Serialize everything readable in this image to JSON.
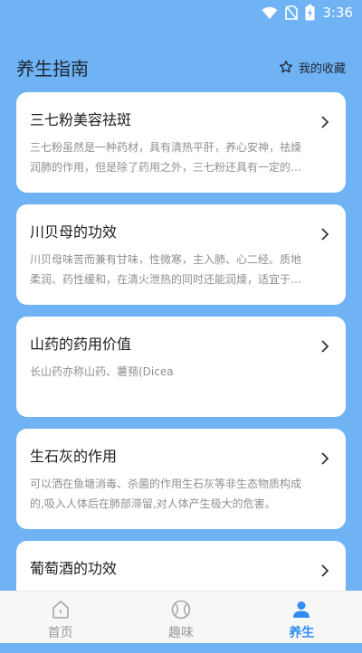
{
  "status": {
    "time": "3:36"
  },
  "header": {
    "title": "养生指南",
    "favorites_label": "我的收藏"
  },
  "cards": [
    {
      "title": "三七粉美容祛斑",
      "desc": "三七粉虽然是一种药材，具有清热平肝，养心安神，祛燥润肺的作用，但是除了药用之外，三七粉还具有一定的美容功效"
    },
    {
      "title": "川贝母的功效",
      "desc": "川贝母味苦而兼有甘味，性微寒，主入肺、心二经。质地柔润、药性缓和，在清火泄热的同时还能润燥，适宜于肺热燥咳"
    },
    {
      "title": "山药的药用价值",
      "desc": "长山药亦称山药、薯蓣(Dicea"
    },
    {
      "title": "生石灰的作用",
      "desc": "可以洒在鱼塘消毒、杀菌的作用生石灰等非生态物质构成的,吸入人体后在肺部滞留,对人体产生极大的危害。"
    },
    {
      "title": "葡萄酒的功效",
      "desc": ""
    }
  ],
  "tabs": [
    {
      "label": "首页",
      "active": false
    },
    {
      "label": "趣味",
      "active": false
    },
    {
      "label": "养生",
      "active": true
    }
  ],
  "colors": {
    "background": "#6fb3f5",
    "accent": "#2f8df2",
    "inactive": "#9a9a9a"
  },
  "icons": [
    "wifi-icon",
    "no-sim-icon",
    "battery-icon",
    "star-icon",
    "chevron-right-icon",
    "home-icon",
    "ball-icon",
    "person-icon"
  ]
}
